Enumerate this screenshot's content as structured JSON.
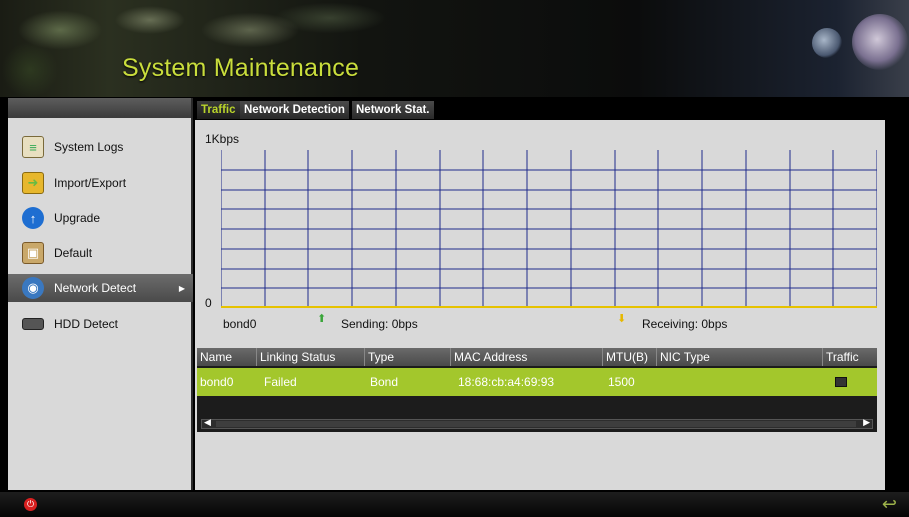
{
  "header": {
    "title": "System Maintenance"
  },
  "menu": {
    "items": [
      {
        "label": "System Logs",
        "icon": "document-log-icon",
        "active": false
      },
      {
        "label": "Import/Export",
        "icon": "folder-import-icon",
        "active": false
      },
      {
        "label": "Upgrade",
        "icon": "upgrade-arrow-icon",
        "active": false
      },
      {
        "label": "Default",
        "icon": "box-default-icon",
        "active": false
      },
      {
        "label": "Network Detect",
        "icon": "network-globe-icon",
        "active": true
      },
      {
        "label": "HDD Detect",
        "icon": "hdd-icon",
        "active": false
      }
    ]
  },
  "tabs": [
    {
      "label": "Traffic",
      "active": true
    },
    {
      "label": "Network Detection",
      "active": false
    },
    {
      "label": "Network Stat.",
      "active": false
    }
  ],
  "graph": {
    "y_top_label": "1Kbps",
    "y_bottom_label": "0",
    "interface": "bond0",
    "sending_label": "Sending: 0bps",
    "receiving_label": "Receiving: 0bps",
    "grid_color": "#1e2a8a",
    "baseline_color": "#e6c200",
    "sending_color": "#3aa53a",
    "receiving_color": "#e6b800"
  },
  "table": {
    "headers": [
      "Name",
      "Linking Status",
      "Type",
      "MAC Address",
      "MTU(B)",
      "NIC Type",
      "Traffic"
    ],
    "rows": [
      [
        "bond0",
        "Failed",
        "Bond",
        "18:68:cb:a4:69:93",
        "1500",
        ""
      ]
    ],
    "selected_row_color": "#a3c72c"
  },
  "colors": {
    "accent": "#c9dd3c",
    "panel_bg": "#d9d9d9"
  }
}
